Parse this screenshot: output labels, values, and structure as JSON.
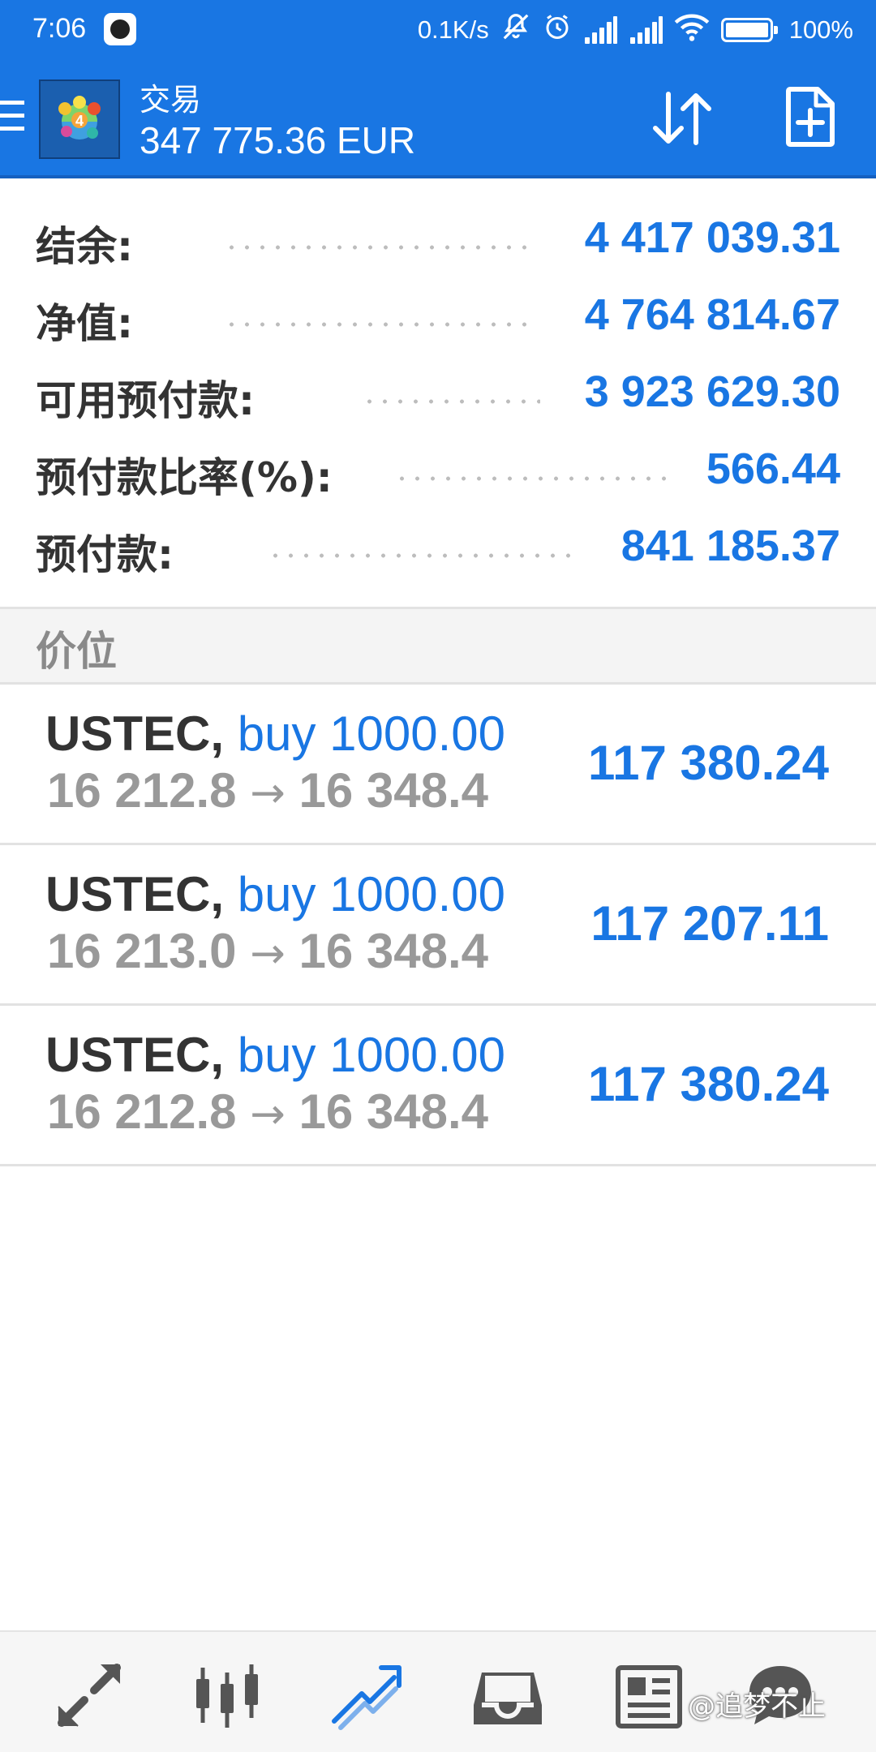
{
  "status_bar": {
    "time": "7:06",
    "net_speed": "0.1K/s",
    "battery_pct": "100%",
    "icons": [
      "clock-app-icon",
      "mute-icon",
      "alarm-icon",
      "signal-icon",
      "signal-icon",
      "wifi-icon",
      "battery-icon"
    ]
  },
  "header": {
    "title": "交易",
    "balance": "347 775.36 EUR",
    "accent_color": "#1976e3"
  },
  "summary": {
    "rows": [
      {
        "label": "结余:",
        "value": "4 417 039.31"
      },
      {
        "label": "净值:",
        "value": "4 764 814.67"
      },
      {
        "label": "可用预付款:",
        "value": "3 923 629.30"
      },
      {
        "label": "预付款比率(%):",
        "value": "566.44"
      },
      {
        "label": "预付款:",
        "value": "841 185.37"
      }
    ]
  },
  "positions": {
    "title": "价位",
    "items": [
      {
        "symbol": "USTEC,",
        "side": "buy",
        "volume": "1000.00",
        "open_price": "16 212.8",
        "arrow": "→",
        "current_price": "16 348.4",
        "profit": "117 380.24"
      },
      {
        "symbol": "USTEC,",
        "side": "buy",
        "volume": "1000.00",
        "open_price": "16 213.0",
        "arrow": "→",
        "current_price": "16 348.4",
        "profit": "117 207.11"
      },
      {
        "symbol": "USTEC,",
        "side": "buy",
        "volume": "1000.00",
        "open_price": "16 212.8",
        "arrow": "→",
        "current_price": "16 348.4",
        "profit": "117 380.24"
      }
    ]
  },
  "bottom_nav": {
    "items": [
      "quotes-icon",
      "chart-icon",
      "trade-icon",
      "history-icon",
      "news-icon",
      "chat-icon"
    ],
    "active": "trade-icon",
    "watermark": "@追梦不止"
  }
}
